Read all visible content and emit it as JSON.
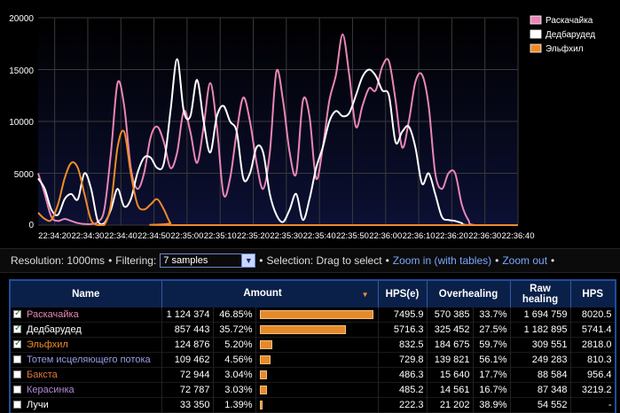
{
  "chart": {
    "y_ticks": [
      "20000",
      "15000",
      "10000",
      "5000",
      "0"
    ],
    "x_ticks": [
      "22:34:20",
      "22:34:30",
      "22:34:40",
      "22:34:50",
      "22:35:00",
      "22:35:10",
      "22:35:20",
      "22:35:30",
      "22:35:40",
      "22:35:50",
      "22:36:00",
      "22:36:10",
      "22:36:20",
      "22:36:30",
      "22:36:40"
    ],
    "legend": [
      {
        "label": "Раскачайка",
        "color": "#e887b6"
      },
      {
        "label": "Дедбарудед",
        "color": "#ffffff"
      },
      {
        "label": "Эльфхил",
        "color": "#f08a2a"
      }
    ]
  },
  "chart_data": {
    "type": "line",
    "ylim": [
      0,
      20000
    ],
    "xlim": [
      "22:34:15",
      "22:36:40"
    ],
    "grid": true,
    "legend_position": "top-right",
    "series": [
      {
        "name": "Раскачайка",
        "color": "#e887b6",
        "points": [
          [
            "22:34:15",
            5000
          ],
          [
            "22:34:17",
            3000
          ],
          [
            "22:34:19",
            800
          ],
          [
            "22:34:21",
            400
          ],
          [
            "22:34:23",
            600
          ],
          [
            "22:34:25",
            400
          ],
          [
            "22:34:27",
            200
          ],
          [
            "22:34:29",
            100
          ],
          [
            "22:34:31",
            100
          ],
          [
            "22:34:33",
            300
          ],
          [
            "22:34:35",
            1500
          ],
          [
            "22:34:37",
            7000
          ],
          [
            "22:34:39",
            13700
          ],
          [
            "22:34:41",
            11500
          ],
          [
            "22:34:43",
            5500
          ],
          [
            "22:34:45",
            3500
          ],
          [
            "22:34:47",
            5000
          ],
          [
            "22:34:49",
            8500
          ],
          [
            "22:34:51",
            9500
          ],
          [
            "22:34:53",
            8000
          ],
          [
            "22:34:55",
            5500
          ],
          [
            "22:34:57",
            7000
          ],
          [
            "22:34:59",
            11000
          ],
          [
            "22:35:01",
            9000
          ],
          [
            "22:35:03",
            6000
          ],
          [
            "22:35:05",
            9500
          ],
          [
            "22:35:07",
            13700
          ],
          [
            "22:35:09",
            9500
          ],
          [
            "22:35:11",
            3000
          ],
          [
            "22:35:13",
            4500
          ],
          [
            "22:35:15",
            9000
          ],
          [
            "22:35:17",
            12300
          ],
          [
            "22:35:19",
            10000
          ],
          [
            "22:35:21",
            6000
          ],
          [
            "22:35:23",
            3500
          ],
          [
            "22:35:25",
            7000
          ],
          [
            "22:35:27",
            14800
          ],
          [
            "22:35:29",
            12000
          ],
          [
            "22:35:31",
            7000
          ],
          [
            "22:35:33",
            5000
          ],
          [
            "22:35:35",
            12000
          ],
          [
            "22:35:37",
            10500
          ],
          [
            "22:35:39",
            4500
          ],
          [
            "22:35:41",
            7500
          ],
          [
            "22:35:43",
            12000
          ],
          [
            "22:35:45",
            14500
          ],
          [
            "22:35:47",
            18400
          ],
          [
            "22:35:49",
            14500
          ],
          [
            "22:35:51",
            9500
          ],
          [
            "22:35:53",
            11500
          ],
          [
            "22:35:55",
            13200
          ],
          [
            "22:35:57",
            13000
          ],
          [
            "22:35:59",
            15300
          ],
          [
            "22:36:01",
            15800
          ],
          [
            "22:36:03",
            12000
          ],
          [
            "22:36:05",
            7500
          ],
          [
            "22:36:07",
            10000
          ],
          [
            "22:36:09",
            13800
          ],
          [
            "22:36:11",
            14500
          ],
          [
            "22:36:13",
            11500
          ],
          [
            "22:36:15",
            5000
          ],
          [
            "22:36:17",
            3500
          ],
          [
            "22:36:19",
            5000
          ],
          [
            "22:36:21",
            5000
          ],
          [
            "22:36:23",
            2000
          ],
          [
            "22:36:25",
            500
          ],
          [
            "22:36:27",
            0
          ],
          [
            "22:36:40",
            0
          ]
        ]
      },
      {
        "name": "Дедбарудед",
        "color": "#ffffff",
        "points": [
          [
            "22:34:15",
            4500
          ],
          [
            "22:34:17",
            3500
          ],
          [
            "22:34:19",
            1500
          ],
          [
            "22:34:21",
            1000
          ],
          [
            "22:34:23",
            2500
          ],
          [
            "22:34:25",
            3000
          ],
          [
            "22:34:27",
            2500
          ],
          [
            "22:34:29",
            5000
          ],
          [
            "22:34:31",
            3500
          ],
          [
            "22:34:33",
            400
          ],
          [
            "22:34:35",
            200
          ],
          [
            "22:34:37",
            1500
          ],
          [
            "22:34:39",
            3500
          ],
          [
            "22:34:41",
            1800
          ],
          [
            "22:34:43",
            2500
          ],
          [
            "22:34:45",
            5000
          ],
          [
            "22:34:47",
            6500
          ],
          [
            "22:34:49",
            6500
          ],
          [
            "22:34:51",
            5500
          ],
          [
            "22:34:53",
            6000
          ],
          [
            "22:34:55",
            11000
          ],
          [
            "22:34:57",
            16000
          ],
          [
            "22:34:59",
            11000
          ],
          [
            "22:35:01",
            10500
          ],
          [
            "22:35:03",
            14000
          ],
          [
            "22:35:05",
            10000
          ],
          [
            "22:35:07",
            7000
          ],
          [
            "22:35:09",
            10500
          ],
          [
            "22:35:11",
            11500
          ],
          [
            "22:35:13",
            10000
          ],
          [
            "22:35:15",
            9000
          ],
          [
            "22:35:17",
            4500
          ],
          [
            "22:35:19",
            5000
          ],
          [
            "22:35:21",
            7500
          ],
          [
            "22:35:23",
            7000
          ],
          [
            "22:35:25",
            3000
          ],
          [
            "22:35:27",
            1000
          ],
          [
            "22:35:29",
            300
          ],
          [
            "22:35:31",
            1500
          ],
          [
            "22:35:33",
            3000
          ],
          [
            "22:35:35",
            500
          ],
          [
            "22:35:37",
            2500
          ],
          [
            "22:35:39",
            5500
          ],
          [
            "22:35:41",
            7500
          ],
          [
            "22:35:43",
            10000
          ],
          [
            "22:35:45",
            11000
          ],
          [
            "22:35:47",
            10500
          ],
          [
            "22:35:49",
            10800
          ],
          [
            "22:35:51",
            12500
          ],
          [
            "22:35:53",
            14300
          ],
          [
            "22:35:55",
            15000
          ],
          [
            "22:35:57",
            14400
          ],
          [
            "22:35:59",
            13000
          ],
          [
            "22:36:01",
            12500
          ],
          [
            "22:36:03",
            8000
          ],
          [
            "22:36:05",
            9000
          ],
          [
            "22:36:07",
            9500
          ],
          [
            "22:36:09",
            7500
          ],
          [
            "22:36:11",
            4000
          ],
          [
            "22:36:13",
            5000
          ],
          [
            "22:36:15",
            3000
          ],
          [
            "22:36:17",
            800
          ],
          [
            "22:36:19",
            500
          ],
          [
            "22:36:21",
            400
          ],
          [
            "22:36:23",
            200
          ],
          [
            "22:36:25",
            0
          ],
          [
            "22:36:40",
            0
          ]
        ]
      },
      {
        "name": "Эльфхил",
        "color": "#f08a2a",
        "points": [
          [
            "22:34:15",
            1200
          ],
          [
            "22:34:17",
            600
          ],
          [
            "22:34:19",
            500
          ],
          [
            "22:34:21",
            2000
          ],
          [
            "22:34:23",
            4500
          ],
          [
            "22:34:25",
            6000
          ],
          [
            "22:34:27",
            5500
          ],
          [
            "22:34:29",
            3000
          ],
          [
            "22:34:31",
            500
          ],
          [
            "22:34:33",
            0
          ],
          [
            "22:34:35",
            0
          ],
          [
            "22:34:37",
            2000
          ],
          [
            "22:34:39",
            7500
          ],
          [
            "22:34:41",
            9000
          ],
          [
            "22:34:43",
            5000
          ],
          [
            "22:34:45",
            2000
          ],
          [
            "22:34:47",
            1500
          ],
          [
            "22:34:49",
            2000
          ],
          [
            "22:34:51",
            2500
          ],
          [
            "22:34:53",
            1500
          ],
          [
            "22:34:55",
            200
          ],
          [
            "22:34:57",
            0
          ],
          [
            "22:36:40",
            0
          ]
        ]
      }
    ]
  },
  "controls": {
    "resolution_label": "Resolution: 1000ms",
    "bullet": "•",
    "filtering_label": "Filtering:",
    "filter_value": "7 samples",
    "selection_label": "Selection: Drag to select",
    "zoom_in_link": "Zoom in (with tables)",
    "zoom_out_link": "Zoom out",
    "dropdown_glyph": "▼"
  },
  "table": {
    "headers": {
      "name": "Name",
      "amount": "Amount",
      "sort_arrow": "▼",
      "hps_e": "HPS(e)",
      "overhealing": "Overhealing",
      "raw_healing": "Raw healing",
      "hps": "HPS"
    },
    "rows": [
      {
        "checked": true,
        "name": "Раскачайка",
        "name_color": "#e887b6",
        "amount": "1 124 374",
        "pct": "46.85%",
        "bar": 0.4685,
        "hps_e": "7495.9",
        "over": "570 385",
        "over_pct": "33.7%",
        "raw": "1 694 759",
        "hps": "8020.5"
      },
      {
        "checked": true,
        "name": "Дедбарудед",
        "name_color": "#ffffff",
        "amount": "857 443",
        "pct": "35.72%",
        "bar": 0.3572,
        "hps_e": "5716.3",
        "over": "325 452",
        "over_pct": "27.5%",
        "raw": "1 182 895",
        "hps": "5741.4"
      },
      {
        "checked": true,
        "name": "Эльфхил",
        "name_color": "#f08a2a",
        "amount": "124 876",
        "pct": "5.20%",
        "bar": 0.052,
        "hps_e": "832.5",
        "over": "184 675",
        "over_pct": "59.7%",
        "raw": "309 551",
        "hps": "2818.0"
      },
      {
        "checked": false,
        "name": "Тотем исцеляющего потока",
        "name_color": "#9a9ae8",
        "amount": "109 462",
        "pct": "4.56%",
        "bar": 0.0456,
        "hps_e": "729.8",
        "over": "139 821",
        "over_pct": "56.1%",
        "raw": "249 283",
        "hps": "810.3"
      },
      {
        "checked": false,
        "name": "Бакста",
        "name_color": "#e07a3a",
        "amount": "72 944",
        "pct": "3.04%",
        "bar": 0.0304,
        "hps_e": "486.3",
        "over": "15 640",
        "over_pct": "17.7%",
        "raw": "88 584",
        "hps": "956.4"
      },
      {
        "checked": false,
        "name": "Керасинка",
        "name_color": "#b38ad9",
        "amount": "72 787",
        "pct": "3.03%",
        "bar": 0.0303,
        "hps_e": "485.2",
        "over": "14 561",
        "over_pct": "16.7%",
        "raw": "87 348",
        "hps": "3219.2"
      },
      {
        "checked": false,
        "name": "Лучи",
        "name_color": "#ffffff",
        "amount": "33 350",
        "pct": "1.39%",
        "bar": 0.0139,
        "hps_e": "222.3",
        "over": "21 202",
        "over_pct": "38.9%",
        "raw": "54 552",
        "hps": "-"
      }
    ]
  }
}
